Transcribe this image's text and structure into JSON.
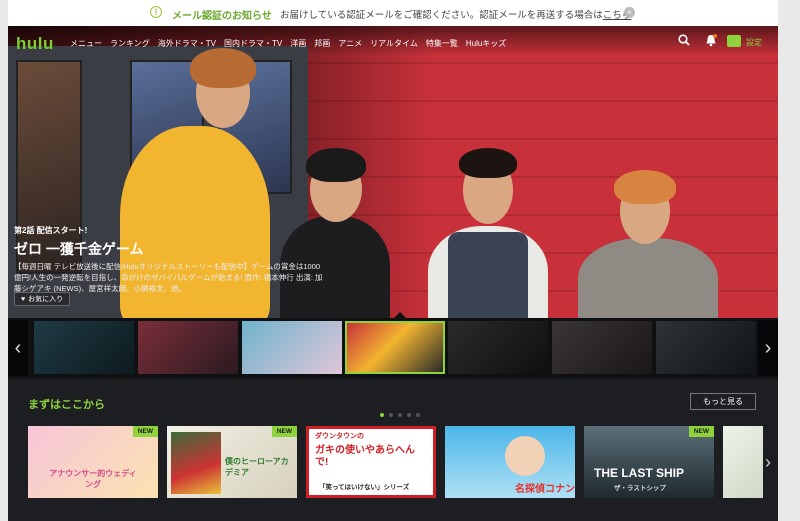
{
  "notice": {
    "title": "メール認証のお知らせ",
    "message": "お届けしている認証メールをご確認ください。認証メールを再送する場合は",
    "link": "こちら"
  },
  "header": {
    "logo": "hulu",
    "nav": [
      "メニュー",
      "ランキング",
      "海外ドラマ・TV",
      "国内ドラマ・TV",
      "洋画",
      "邦画",
      "アニメ",
      "リアルタイム",
      "特集一覧",
      "Huluキッズ"
    ],
    "user_label": "設定"
  },
  "hero": {
    "episode": "第2話 配信スタート!",
    "title": "ゼロ 一獲千金ゲーム",
    "description": "【毎週日曜 テレビ放送後に配信/Huluオリジナルストーリーも配信中】ゲームの賞金は1000億円!人生の一発逆転を目指し、命がけのサバイバルゲームが始まる! 原作: 福本伸行 出演: 加藤シゲアキ (NEWS)、屋宮祥太朗、小関裕太、他。",
    "favorite_label": "お気に入り"
  },
  "section": {
    "title": "まずはここから",
    "more_label": "もっと見る",
    "cards": [
      {
        "label": "アナウンサー的ウェディング",
        "badge": "NEW"
      },
      {
        "label": "僕のヒーローアカデミア",
        "badge": "NEW"
      },
      {
        "label": "ガキの使いやあらへんで!",
        "sub": "「笑ってはいけない」シリーズ",
        "top": "ダウンタウンの",
        "badge": ""
      },
      {
        "label": "名探偵コナン",
        "badge": ""
      },
      {
        "label": "THE LAST SHIP",
        "sub": "ザ・ラストシップ",
        "badge": "NEW"
      }
    ]
  },
  "colors": {
    "accent": "#8fd33c",
    "hero_wall": "#c8313a"
  }
}
